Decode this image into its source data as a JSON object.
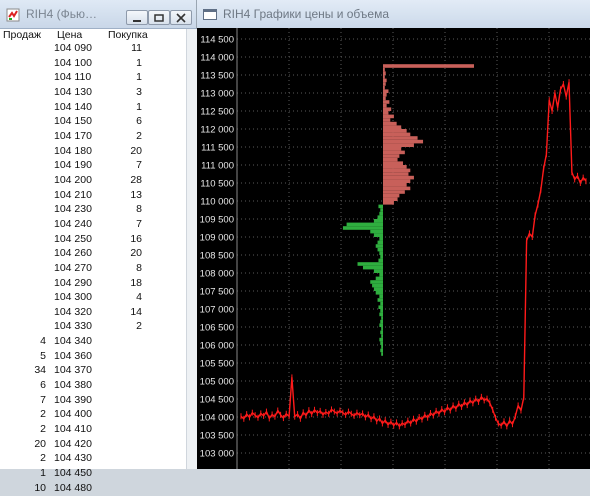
{
  "book_window": {
    "title": "RIH4 (Фью…",
    "headers": {
      "sell": "Продаж",
      "price": "Цена",
      "buy": "Покупка"
    },
    "rows": [
      {
        "sell": "",
        "price": "104 090",
        "buy": "11"
      },
      {
        "sell": "",
        "price": "104 100",
        "buy": "1"
      },
      {
        "sell": "",
        "price": "104 110",
        "buy": "1"
      },
      {
        "sell": "",
        "price": "104 130",
        "buy": "3"
      },
      {
        "sell": "",
        "price": "104 140",
        "buy": "1"
      },
      {
        "sell": "",
        "price": "104 150",
        "buy": "6"
      },
      {
        "sell": "",
        "price": "104 170",
        "buy": "2"
      },
      {
        "sell": "",
        "price": "104 180",
        "buy": "20"
      },
      {
        "sell": "",
        "price": "104 190",
        "buy": "7"
      },
      {
        "sell": "",
        "price": "104 200",
        "buy": "28"
      },
      {
        "sell": "",
        "price": "104 210",
        "buy": "13"
      },
      {
        "sell": "",
        "price": "104 230",
        "buy": "8"
      },
      {
        "sell": "",
        "price": "104 240",
        "buy": "7"
      },
      {
        "sell": "",
        "price": "104 250",
        "buy": "16"
      },
      {
        "sell": "",
        "price": "104 260",
        "buy": "20"
      },
      {
        "sell": "",
        "price": "104 270",
        "buy": "8"
      },
      {
        "sell": "",
        "price": "104 290",
        "buy": "18"
      },
      {
        "sell": "",
        "price": "104 300",
        "buy": "4"
      },
      {
        "sell": "",
        "price": "104 320",
        "buy": "14"
      },
      {
        "sell": "",
        "price": "104 330",
        "buy": "2"
      },
      {
        "sell": "4",
        "price": "104 340",
        "buy": ""
      },
      {
        "sell": "5",
        "price": "104 360",
        "buy": ""
      },
      {
        "sell": "34",
        "price": "104 370",
        "buy": ""
      },
      {
        "sell": "6",
        "price": "104 380",
        "buy": ""
      },
      {
        "sell": "7",
        "price": "104 390",
        "buy": ""
      },
      {
        "sell": "2",
        "price": "104 400",
        "buy": ""
      },
      {
        "sell": "2",
        "price": "104 410",
        "buy": ""
      },
      {
        "sell": "20",
        "price": "104 420",
        "buy": ""
      },
      {
        "sell": "2",
        "price": "104 430",
        "buy": ""
      },
      {
        "sell": "1",
        "price": "104 450",
        "buy": ""
      },
      {
        "sell": "10",
        "price": "104 480",
        "buy": ""
      }
    ]
  },
  "chart_window": {
    "title": "RIH4 Графики цены и объема"
  },
  "chart_data": {
    "type": "line",
    "y_ticks": [
      "114 500",
      "114 000",
      "113 500",
      "113 000",
      "112 500",
      "112 000",
      "111 500",
      "111 000",
      "110 500",
      "110 000",
      "109 500",
      "109 000",
      "108 500",
      "108 000",
      "107 500",
      "107 000",
      "106 500",
      "106 000",
      "105 500",
      "105 000",
      "104 500",
      "104 000",
      "103 500",
      "103 000"
    ],
    "ylim": [
      102900,
      114550
    ],
    "grid": true,
    "colors": {
      "price_line": "#ff1a1a",
      "volume_sell": "#c8605a",
      "volume_buy": "#2fae3f",
      "grid": "#5a5a5a",
      "background": "#000000"
    },
    "price_series": [
      104020,
      103950,
      104080,
      103990,
      104120,
      104050,
      103980,
      104100,
      104030,
      104150,
      103960,
      104070,
      104010,
      104180,
      104060,
      103970,
      104090,
      104020,
      105100,
      104010,
      104080,
      103950,
      104130,
      104040,
      104190,
      104080,
      104200,
      104110,
      104170,
      104060,
      104140,
      104090,
      104210,
      104150,
      104100,
      104180,
      104120,
      104060,
      104150,
      104090,
      104030,
      104120,
      104050,
      104100,
      103990,
      104070,
      103940,
      104020,
      103880,
      103960,
      103820,
      103910,
      103780,
      103870,
      103760,
      103850,
      103740,
      103830,
      103780,
      103900,
      103820,
      103950,
      103870,
      104000,
      103930,
      104060,
      103980,
      104110,
      104040,
      104170,
      104090,
      104220,
      104130,
      104270,
      104180,
      104320,
      104230,
      104370,
      104280,
      104410,
      104330,
      104460,
      104380,
      104510,
      104420,
      104560,
      104460,
      104510,
      104380,
      104200,
      103980,
      103820,
      103760,
      103880,
      103740,
      103900,
      103800,
      104020,
      104320,
      104180,
      104550,
      108900,
      109100,
      109000,
      109600,
      109900,
      110300,
      110900,
      111300,
      112800,
      112500,
      113000,
      112600,
      113100,
      113250,
      112900,
      113300,
      110800,
      110600,
      110700,
      110500,
      110650,
      110550
    ],
    "volume_profile": [
      {
        "price": 113750,
        "volume": 100
      },
      {
        "price": 113650,
        "volume": 2
      },
      {
        "price": 113550,
        "volume": 3
      },
      {
        "price": 113450,
        "volume": 2
      },
      {
        "price": 113350,
        "volume": 4
      },
      {
        "price": 113250,
        "volume": 3
      },
      {
        "price": 113150,
        "volume": 2
      },
      {
        "price": 113050,
        "volume": 6
      },
      {
        "price": 112950,
        "volume": 4
      },
      {
        "price": 112850,
        "volume": 3
      },
      {
        "price": 112750,
        "volume": 7
      },
      {
        "price": 112650,
        "volume": 4
      },
      {
        "price": 112550,
        "volume": 9
      },
      {
        "price": 112450,
        "volume": 6
      },
      {
        "price": 112350,
        "volume": 12
      },
      {
        "price": 112250,
        "volume": 8
      },
      {
        "price": 112150,
        "volume": 15
      },
      {
        "price": 112050,
        "volume": 20
      },
      {
        "price": 111950,
        "volume": 26
      },
      {
        "price": 111850,
        "volume": 30
      },
      {
        "price": 111750,
        "volume": 38
      },
      {
        "price": 111650,
        "volume": 44
      },
      {
        "price": 111550,
        "volume": 34
      },
      {
        "price": 111450,
        "volume": 20
      },
      {
        "price": 111350,
        "volume": 24
      },
      {
        "price": 111250,
        "volume": 18
      },
      {
        "price": 111150,
        "volume": 16
      },
      {
        "price": 111050,
        "volume": 22
      },
      {
        "price": 110950,
        "volume": 26
      },
      {
        "price": 110850,
        "volume": 30
      },
      {
        "price": 110750,
        "volume": 28
      },
      {
        "price": 110650,
        "volume": 34
      },
      {
        "price": 110550,
        "volume": 30
      },
      {
        "price": 110450,
        "volume": 26
      },
      {
        "price": 110350,
        "volume": 30
      },
      {
        "price": 110250,
        "volume": 24
      },
      {
        "price": 110150,
        "volume": 18
      },
      {
        "price": 110050,
        "volume": 16
      },
      {
        "price": 109950,
        "volume": 12
      },
      {
        "price": 109850,
        "volume": -5
      },
      {
        "price": 109750,
        "volume": -3
      },
      {
        "price": 109650,
        "volume": -4
      },
      {
        "price": 109550,
        "volume": -6
      },
      {
        "price": 109450,
        "volume": -10
      },
      {
        "price": 109350,
        "volume": -40
      },
      {
        "price": 109250,
        "volume": -44
      },
      {
        "price": 109150,
        "volume": -14
      },
      {
        "price": 109050,
        "volume": -10
      },
      {
        "price": 108950,
        "volume": -4
      },
      {
        "price": 108850,
        "volume": -6
      },
      {
        "price": 108750,
        "volume": -8
      },
      {
        "price": 108650,
        "volume": -6
      },
      {
        "price": 108550,
        "volume": -4
      },
      {
        "price": 108450,
        "volume": -3
      },
      {
        "price": 108350,
        "volume": -5
      },
      {
        "price": 108250,
        "volume": -28
      },
      {
        "price": 108150,
        "volume": -22
      },
      {
        "price": 108050,
        "volume": -10
      },
      {
        "price": 107950,
        "volume": -4
      },
      {
        "price": 107850,
        "volume": -8
      },
      {
        "price": 107750,
        "volume": -14
      },
      {
        "price": 107650,
        "volume": -12
      },
      {
        "price": 107550,
        "volume": -10
      },
      {
        "price": 107450,
        "volume": -8
      },
      {
        "price": 107350,
        "volume": -4
      },
      {
        "price": 107250,
        "volume": -6
      },
      {
        "price": 107150,
        "volume": -3
      },
      {
        "price": 107050,
        "volume": -5
      },
      {
        "price": 106950,
        "volume": -3
      },
      {
        "price": 106850,
        "volume": -4
      },
      {
        "price": 106750,
        "volume": -2
      },
      {
        "price": 106650,
        "volume": -3
      },
      {
        "price": 106550,
        "volume": -4
      },
      {
        "price": 106450,
        "volume": -2
      },
      {
        "price": 106350,
        "volume": -3
      },
      {
        "price": 106250,
        "volume": -2
      },
      {
        "price": 106150,
        "volume": -4
      },
      {
        "price": 106050,
        "volume": -3
      },
      {
        "price": 105950,
        "volume": -2
      },
      {
        "price": 105850,
        "volume": -3
      },
      {
        "price": 105750,
        "volume": -2
      }
    ]
  }
}
